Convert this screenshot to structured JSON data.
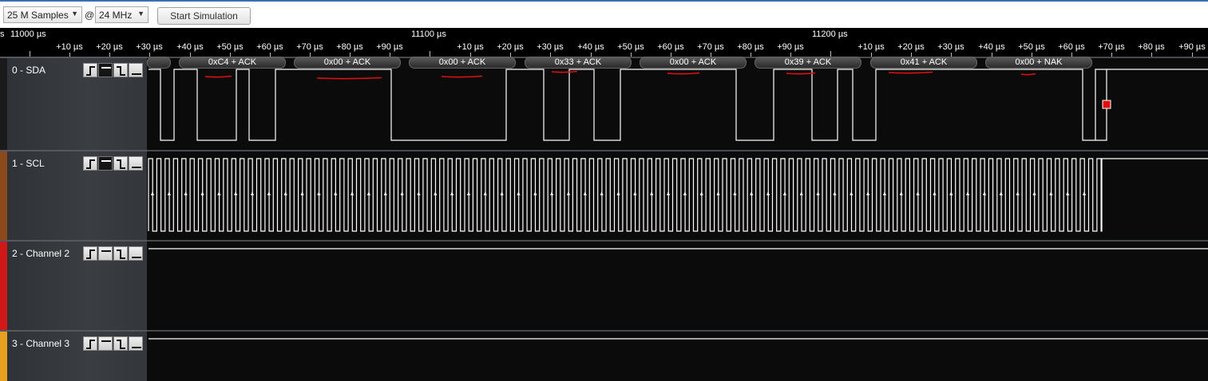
{
  "toolbar": {
    "samples": "25 M Samples",
    "at": "@",
    "rate": "24 MHz",
    "start_label": "Start Simulation"
  },
  "ruler": {
    "majors": [
      {
        "label": "s"
      },
      {
        "label": "11000 µs"
      },
      {
        "label": "11100 µs"
      },
      {
        "label": "11200 µs"
      }
    ],
    "ticks": [
      "+10 µs",
      "+20 µs",
      "+30 µs",
      "+40 µs",
      "+50 µs",
      "+60 µs",
      "+70 µs",
      "+80 µs",
      "+90 µs",
      "+10 µs",
      "+20 µs",
      "+30 µs",
      "+40 µs",
      "+50 µs",
      "+60 µs",
      "+70 µs",
      "+80 µs",
      "+90 µs",
      "+10 µs",
      "+20 µs",
      "+30 µs",
      "+40 µs",
      "+50 µs",
      "+60 µs",
      "+70 µs",
      "+80 µs",
      "+90 µs"
    ]
  },
  "channels": [
    {
      "name": "0 - SDA",
      "stripe_color": "#1a1a1a"
    },
    {
      "name": "1 - SCL",
      "stripe_color": "#8b4a1c"
    },
    {
      "name": "2 - Channel 2",
      "stripe_color": "#d01818"
    },
    {
      "name": "3 - Channel 3",
      "stripe_color": "#e8a020"
    }
  ],
  "i2c_annotations": [
    "0xC4 + ACK",
    "0x00 + ACK",
    "0x00 + ACK",
    "0x33 + ACK",
    "0x00 + ACK",
    "0x39 + ACK",
    "0x41 + ACK",
    "0x00 + NAK"
  ],
  "colors": {
    "trace": "#ffffff",
    "marker": "#e01010",
    "underline": "#e01010"
  }
}
